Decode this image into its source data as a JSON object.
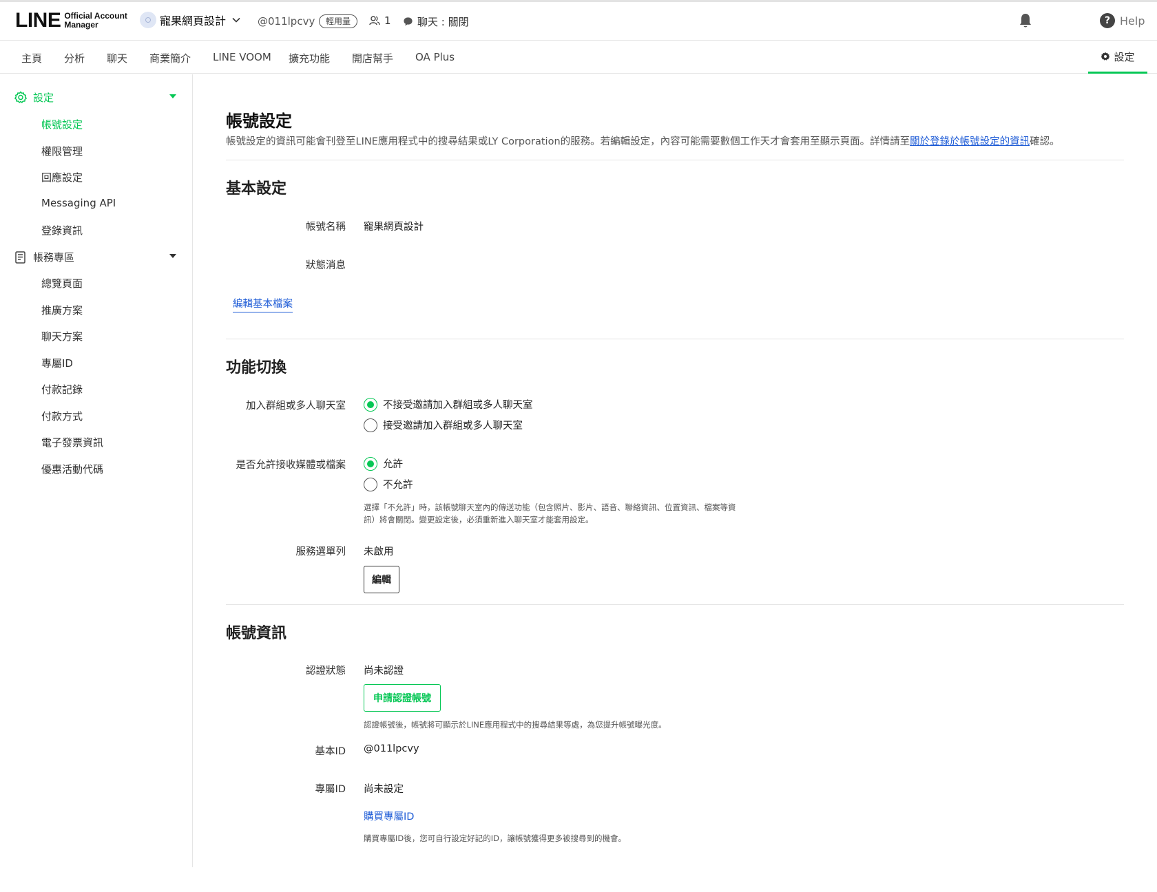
{
  "header": {
    "logo_main": "LINE",
    "logo_sub_1": "Official Account",
    "logo_sub_2": "Manager",
    "account_name": "寵果網頁設計",
    "account_id": "@011lpcvy",
    "plan_badge": "輕用量",
    "friends_count": "1",
    "chat_status": "聊天 : 關閉",
    "help_label": "Help"
  },
  "nav": {
    "items": [
      "主頁",
      "分析",
      "聊天",
      "商業簡介",
      "LINE VOOM",
      "擴充功能",
      "開店幫手",
      "OA Plus"
    ],
    "settings_label": "設定"
  },
  "sidebar": {
    "settings_group": "設定",
    "settings_items": [
      "帳號設定",
      "權限管理",
      "回應設定",
      "Messaging API",
      "登錄資訊"
    ],
    "billing_group": "帳務專區",
    "billing_items": [
      "總覽頁面",
      "推廣方案",
      "聊天方案",
      "專屬ID",
      "付款記錄",
      "付款方式",
      "電子發票資訊",
      "優惠活動代碼"
    ]
  },
  "main": {
    "title": "帳號設定",
    "desc_pre": "帳號設定的資訊可能會刊登至LINE應用程式中的搜尋結果或LY Corporation的服務。若編輯設定，內容可能需要數個工作天才會套用至顯示頁面。詳情請至",
    "desc_link": "關於登錄於帳號設定的資訊",
    "desc_post": "確認。",
    "basic": {
      "title": "基本設定",
      "name_label": "帳號名稱",
      "name_value": "寵果網頁設計",
      "status_label": "狀態消息",
      "edit_profile": "編輯基本檔案"
    },
    "features": {
      "title": "功能切換",
      "group_label": "加入群組或多人聊天室",
      "group_opt1": "不接受邀請加入群組或多人聊天室",
      "group_opt2": "接受邀請加入群組或多人聊天室",
      "media_label": "是否允許接收媒體或檔案",
      "media_opt1": "允許",
      "media_opt2": "不允許",
      "media_note_1": "選擇「不允許」時，該帳號聊天室內的傳送功能（包含照片、影片、語音、聯絡資訊、位置資訊、檔案等資",
      "media_note_2": "訊）將會關閉。變更設定後，必須重新進入聊天室才能套用設定。",
      "menu_label": "服務選單列",
      "menu_value": "未啟用",
      "menu_edit": "編輯"
    },
    "info": {
      "title": "帳號資訊",
      "verify_label": "認證狀態",
      "verify_value": "尚未認證",
      "verify_button": "申請認證帳號",
      "verify_note": "認證帳號後，帳號將可顯示於LINE應用程式中的搜尋結果等處，為您提升帳號曝光度。",
      "basic_id_label": "基本ID",
      "basic_id_value": "@011lpcvy",
      "premium_id_label": "專屬ID",
      "premium_id_value": "尚未設定",
      "premium_id_link": "購買專屬ID",
      "premium_id_note": "購買專屬ID後，您可自行設定好記的ID，讓帳號獲得更多被搜尋到的機會。"
    }
  },
  "colors": {
    "accent": "#06c755",
    "link": "#1d5bd6"
  }
}
